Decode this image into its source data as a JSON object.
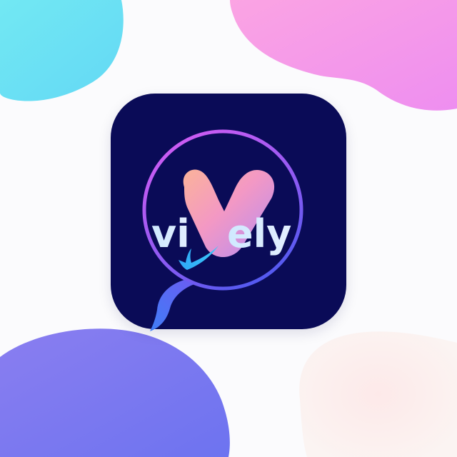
{
  "brand": {
    "wordmark": "vively",
    "wordmark_left": "vi",
    "wordmark_right": "ely",
    "big_letter": "V"
  },
  "colors": {
    "background": "#fbfbfd",
    "icon_bg": "#0a0b57",
    "blob_cyan": "#6fe3f2",
    "blob_pink": "#f59ae6",
    "blob_purple": "#7a73ee",
    "blob_peach": "#fdf0ee",
    "ring_start": "#d35cf2",
    "ring_end": "#4f57f0",
    "text": "#d7e7ff",
    "check": "#35b9f7"
  },
  "icons": {
    "logo": "speech-bubble-ring-with-v-and-checkmark"
  }
}
